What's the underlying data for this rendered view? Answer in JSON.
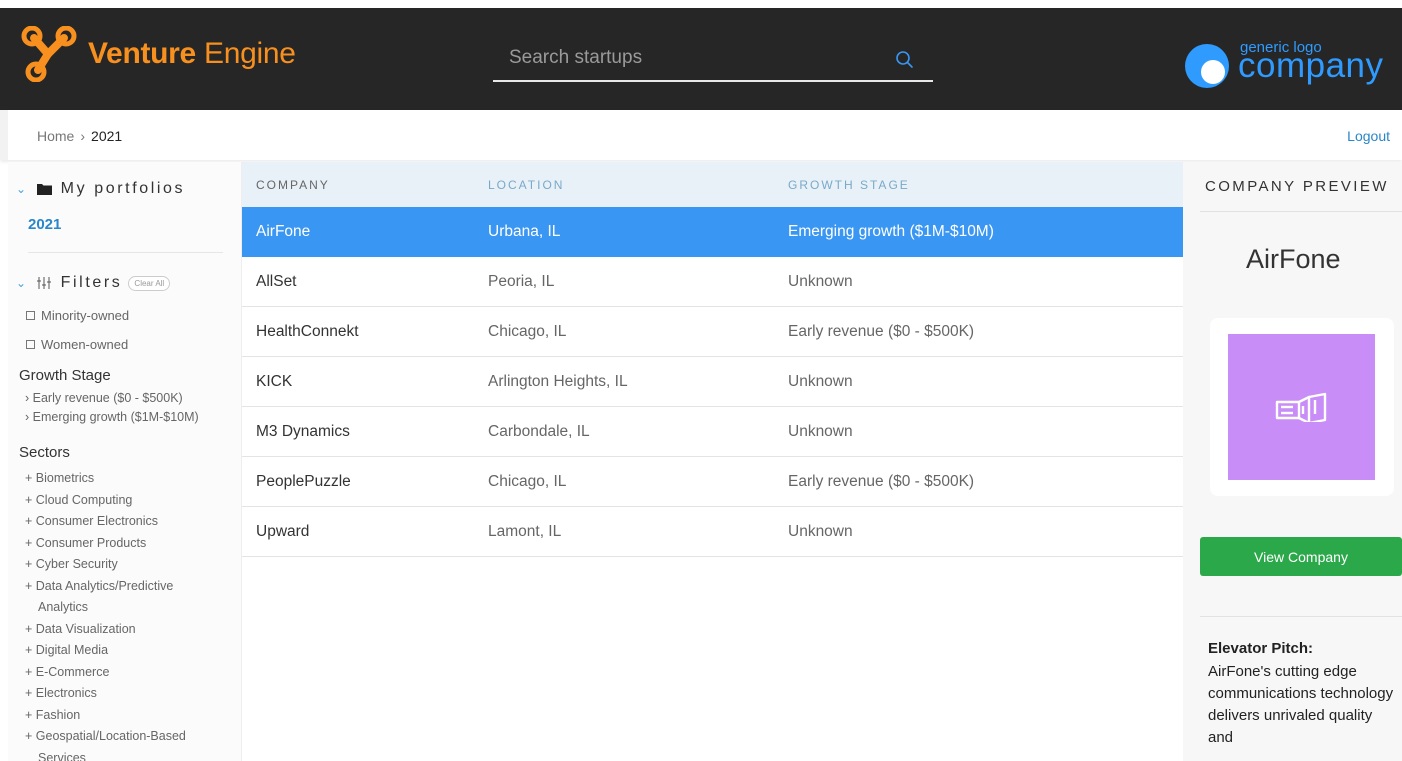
{
  "header": {
    "app_name_bold": "Venture",
    "app_name_light": "Engine",
    "search_placeholder": "Search startups",
    "brand_small": "generic logo",
    "brand_big": "company"
  },
  "breadcrumb": {
    "home": "Home",
    "separator": "›",
    "current": "2021",
    "logout": "Logout"
  },
  "sidebar": {
    "portfolios_label": "My portfolios",
    "portfolio_item": "2021",
    "filters_label": "Filters",
    "clear_all": "Clear All",
    "checkboxes": [
      "Minority-owned",
      "Women-owned"
    ],
    "growth_stage_title": "Growth Stage",
    "growth_stages": [
      "› Early revenue ($0 - $500K)",
      "› Emerging growth ($1M-$10M)"
    ],
    "sectors_title": "Sectors",
    "sectors": [
      {
        "line1": "+ Biometrics"
      },
      {
        "line1": "+ Cloud Computing"
      },
      {
        "line1": "+ Consumer Electronics"
      },
      {
        "line1": "+ Consumer Products"
      },
      {
        "line1": "+ Cyber Security"
      },
      {
        "line1": "+ Data Analytics/Predictive",
        "line2": "Analytics"
      },
      {
        "line1": "+ Data Visualization"
      },
      {
        "line1": "+ Digital Media"
      },
      {
        "line1": "+ E-Commerce"
      },
      {
        "line1": "+ Electronics"
      },
      {
        "line1": "+ Fashion"
      },
      {
        "line1": "+ Geospatial/Location-Based",
        "line2": "Services"
      }
    ]
  },
  "table": {
    "headers": [
      "COMPANY",
      "LOCATION",
      "GROWTH STAGE"
    ],
    "rows": [
      {
        "company": "AirFone",
        "location": "Urbana, IL",
        "stage": "Emerging growth ($1M-$10M)"
      },
      {
        "company": "AllSet",
        "location": "Peoria, IL",
        "stage": "Unknown"
      },
      {
        "company": "HealthConnekt",
        "location": "Chicago, IL",
        "stage": "Early revenue ($0 - $500K)"
      },
      {
        "company": "KICK",
        "location": "Arlington Heights, IL",
        "stage": "Unknown"
      },
      {
        "company": "M3 Dynamics",
        "location": "Carbondale, IL",
        "stage": "Unknown"
      },
      {
        "company": "PeoplePuzzle",
        "location": "Chicago, IL",
        "stage": "Early revenue ($0 - $500K)"
      },
      {
        "company": "Upward",
        "location": "Lamont, IL",
        "stage": "Unknown"
      }
    ]
  },
  "preview": {
    "title": "COMPANY PREVIEW",
    "company_name": "AirFone",
    "logo_icon": "megaphone-icon",
    "logo_color": "#c88df7",
    "view_button": "View Company",
    "pitch_heading": "Elevator Pitch:",
    "pitch_text": "AirFone's cutting edge communications technology delivers unrivaled quality and"
  },
  "colors": {
    "header_bg": "#262626",
    "brand_orange": "#f7901e",
    "selected_row": "#3a96f3",
    "link_blue": "#2a86c8",
    "button_green": "#2ba84a"
  }
}
